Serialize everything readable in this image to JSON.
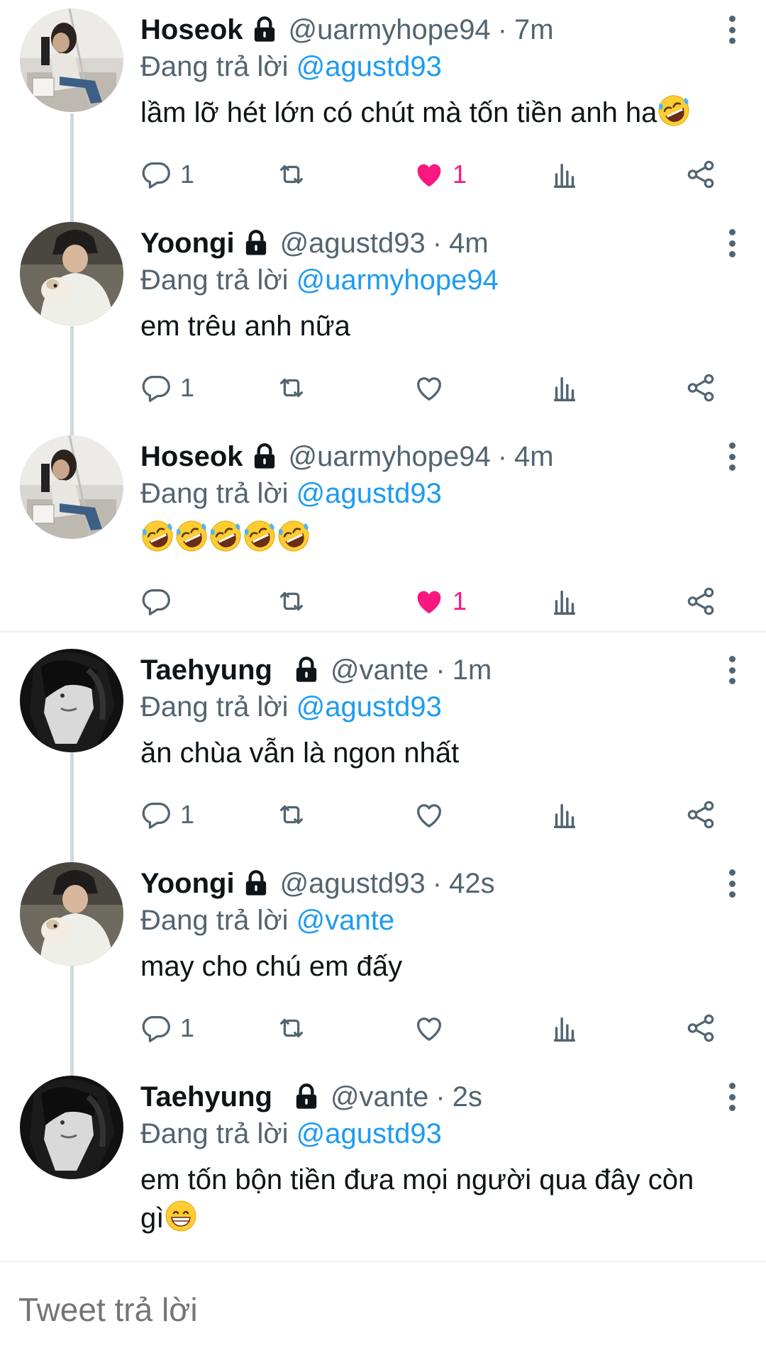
{
  "tweets": [
    {
      "name": "Hoseok",
      "handle": "@uarmyhope94",
      "time": "7m",
      "replying_prefix": "Đang trả lời",
      "replying_to": "@agustd93",
      "text": "lầm lỡ hét lớn có chút mà tốn tiền anh ha",
      "emoji": "rofl",
      "reply_count": "1",
      "like_count": "1",
      "liked": true,
      "avatar": "hoseok-avatar"
    },
    {
      "name": "Yoongi",
      "handle": "@agustd93",
      "time": "4m",
      "replying_prefix": "Đang trả lời",
      "replying_to": "@uarmyhope94",
      "text": "em trêu anh nữa",
      "reply_count": "1",
      "like_count": "",
      "liked": false,
      "avatar": "yoongi-avatar"
    },
    {
      "name": "Hoseok",
      "handle": "@uarmyhope94",
      "time": "4m",
      "replying_prefix": "Đang trả lời",
      "replying_to": "@agustd93",
      "text": "",
      "emoji_row": [
        "rofl",
        "rofl",
        "rofl",
        "rofl",
        "rofl"
      ],
      "reply_count": "",
      "like_count": "1",
      "liked": true,
      "avatar": "hoseok-avatar"
    },
    {
      "name": "Taehyung",
      "handle": "@vante",
      "time": "1m",
      "replying_prefix": "Đang trả lời",
      "replying_to": "@agustd93",
      "text": "ăn chùa vẫn là ngon nhất",
      "reply_count": "1",
      "like_count": "",
      "liked": false,
      "avatar": "taehyung-avatar"
    },
    {
      "name": "Yoongi",
      "handle": "@agustd93",
      "time": "42s",
      "replying_prefix": "Đang trả lời",
      "replying_to": "@vante",
      "text": "may cho chú em đấy",
      "reply_count": "1",
      "like_count": "",
      "liked": false,
      "avatar": "yoongi-avatar"
    },
    {
      "name": "Taehyung",
      "handle": "@vante",
      "time": "2s",
      "replying_prefix": "Đang trả lời",
      "replying_to": "@agustd93",
      "text_line1": "em tốn bộn tiền đưa mọi người qua đây còn",
      "text_line2": "gì",
      "emoji": "grin",
      "avatar": "taehyung-avatar"
    }
  ],
  "separator": "·",
  "composer": {
    "placeholder": "Tweet trả lời"
  },
  "colors": {
    "like": "#f91880",
    "mention": "#1d9bf0",
    "muted": "#536471",
    "thread_line": "#cfd9de"
  },
  "icons": [
    "lock-icon",
    "more-vertical-icon",
    "reply-icon",
    "retweet-icon",
    "heart-icon",
    "heart-filled-icon",
    "stats-icon",
    "share-icon",
    "rofl-emoji",
    "grin-emoji"
  ]
}
